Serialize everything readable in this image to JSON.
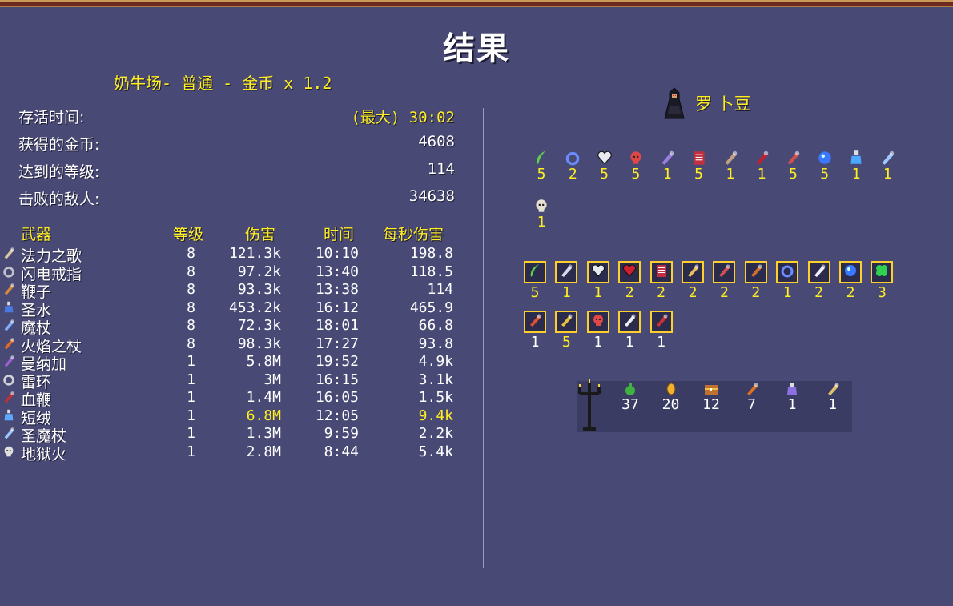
{
  "title": "结果",
  "stage_info": "奶牛场- 普通 - 金币 x 1.2",
  "stats": [
    {
      "label": "存活时间:",
      "prefix": "(最大)",
      "value": "30:02"
    },
    {
      "label": "获得的金币:",
      "prefix": "",
      "value": "4608"
    },
    {
      "label": "达到的等级:",
      "prefix": "",
      "value": "114"
    },
    {
      "label": "击败的敌人:",
      "prefix": "",
      "value": "34638"
    }
  ],
  "table": {
    "headers": {
      "weapon": "武器",
      "level": "等级",
      "damage": "伤害",
      "time": "时间",
      "dps": "每秒伤害"
    },
    "rows": [
      {
        "icon": "scroll-icon",
        "color": "#d9c7a8",
        "name": "法力之歌",
        "level": "8",
        "damage": "121.3k",
        "time": "10:10",
        "dps": "198.8",
        "highlight": false
      },
      {
        "icon": "ring-icon",
        "color": "#c0c0c8",
        "name": "闪电戒指",
        "level": "8",
        "damage": "97.2k",
        "time": "13:40",
        "dps": "118.5",
        "highlight": false
      },
      {
        "icon": "whip-icon",
        "color": "#d88a3a",
        "name": "鞭子",
        "level": "8",
        "damage": "93.3k",
        "time": "13:38",
        "dps": "114",
        "highlight": false
      },
      {
        "icon": "holy-water-icon",
        "color": "#4a78e0",
        "name": "圣水",
        "level": "8",
        "damage": "453.2k",
        "time": "16:12",
        "dps": "465.9",
        "highlight": false
      },
      {
        "icon": "wand-icon",
        "color": "#7fb0ff",
        "name": "魔杖",
        "level": "8",
        "damage": "72.3k",
        "time": "18:01",
        "dps": "66.8",
        "highlight": false
      },
      {
        "icon": "fire-wand-icon",
        "color": "#e06a2a",
        "name": "火焰之杖",
        "level": "8",
        "damage": "98.3k",
        "time": "17:27",
        "dps": "93.8",
        "highlight": false
      },
      {
        "icon": "mannajja-icon",
        "color": "#9b5fd0",
        "name": "曼纳加",
        "level": "1",
        "damage": "5.8M",
        "time": "19:52",
        "dps": "4.9k",
        "highlight": false
      },
      {
        "icon": "thunder-loop-icon",
        "color": "#d0d0d8",
        "name": "雷环",
        "level": "1",
        "damage": "3M",
        "time": "16:15",
        "dps": "3.1k",
        "highlight": false
      },
      {
        "icon": "bloody-whip-icon",
        "color": "#c0303a",
        "name": "血鞭",
        "level": "1",
        "damage": "1.4M",
        "time": "16:05",
        "dps": "1.5k",
        "highlight": false
      },
      {
        "icon": "flask-icon",
        "color": "#5fa8ff",
        "name": "短绒",
        "level": "1",
        "damage": "6.8M",
        "time": "12:05",
        "dps": "9.4k",
        "highlight": true
      },
      {
        "icon": "holy-wand-icon",
        "color": "#a0c8ff",
        "name": "圣魔杖",
        "level": "1",
        "damage": "1.3M",
        "time": "9:59",
        "dps": "2.2k",
        "highlight": false
      },
      {
        "icon": "skull-icon",
        "color": "#e0e0e0",
        "name": "地狱火",
        "level": "1",
        "damage": "2.8M",
        "time": "8:44",
        "dps": "5.4k",
        "highlight": false
      }
    ]
  },
  "character": {
    "name": "罗 卜豆",
    "sprite": "hooded-figure-icon"
  },
  "weapon_icons": [
    {
      "icon": "feather-icon",
      "color": "#5fd04a",
      "count": "5"
    },
    {
      "icon": "ring-icon",
      "color": "#6a8cff",
      "count": "2"
    },
    {
      "icon": "heart-icon",
      "color": "#e8e8f0",
      "count": "5"
    },
    {
      "icon": "skull-red-icon",
      "color": "#e04848",
      "count": "5"
    },
    {
      "icon": "wand-star-icon",
      "color": "#9b7fe0",
      "count": "1"
    },
    {
      "icon": "book-icon",
      "color": "#c03040",
      "count": "5"
    },
    {
      "icon": "clock-icon",
      "color": "#c0a080",
      "count": "1"
    },
    {
      "icon": "red-whip-icon",
      "color": "#c02030",
      "count": "1"
    },
    {
      "icon": "gauntlet-icon",
      "color": "#d05050",
      "count": "5"
    },
    {
      "icon": "orb-icon",
      "color": "#3a78ff",
      "count": "5"
    },
    {
      "icon": "potion-icon",
      "color": "#4aa8ff",
      "count": "1"
    },
    {
      "icon": "holy-wand-icon",
      "color": "#a0c8ff",
      "count": "1"
    },
    {
      "icon": "skull-icon",
      "color": "#e8e0d0",
      "count": "1"
    }
  ],
  "passive_items": [
    {
      "icon": "feather-icon",
      "color": "#5fd04a",
      "count": "5"
    },
    {
      "icon": "wings-icon",
      "color": "#d8d8e8",
      "count": "1"
    },
    {
      "icon": "heart-icon",
      "color": "#e8e8f0",
      "count": "1"
    },
    {
      "icon": "bleeding-heart-icon",
      "color": "#d02030",
      "count": "2"
    },
    {
      "icon": "tome-icon",
      "color": "#c03040",
      "count": "2"
    },
    {
      "icon": "candelabra-icon",
      "color": "#e8c060",
      "count": "2"
    },
    {
      "icon": "gauntlet-icon",
      "color": "#d05050",
      "count": "2"
    },
    {
      "icon": "crossed-swords-icon",
      "color": "#d07030",
      "count": "2"
    },
    {
      "icon": "ring-icon",
      "color": "#6a8cff",
      "count": "1"
    },
    {
      "icon": "wing-icon",
      "color": "#f0f0ff",
      "count": "2"
    },
    {
      "icon": "orb-icon",
      "color": "#3a78ff",
      "count": "2"
    },
    {
      "icon": "clover-icon",
      "color": "#30d050",
      "count": "3"
    },
    {
      "icon": "fire-crown-icon",
      "color": "#e05030",
      "count": "1"
    },
    {
      "icon": "helmet-icon",
      "color": "#e8c040",
      "count": "5"
    },
    {
      "icon": "skull-red-icon",
      "color": "#e04848",
      "count": "1"
    },
    {
      "icon": "dice-icon",
      "color": "#f0f0f0",
      "count": "1"
    },
    {
      "icon": "ghost-icon",
      "color": "#d03030",
      "count": "1"
    }
  ],
  "passive_highlight_index": 13,
  "pickups": [
    {
      "icon": "money-bag-icon",
      "color": "#40b040",
      "count": "37"
    },
    {
      "icon": "gold-coin-icon",
      "color": "#f0b030",
      "count": "20"
    },
    {
      "icon": "treasure-chest-icon",
      "color": "#c07030",
      "count": "12"
    },
    {
      "icon": "roast-chicken-icon",
      "color": "#e07020",
      "count": "7"
    },
    {
      "icon": "magic-potion-icon",
      "color": "#8a70e0",
      "count": "1"
    },
    {
      "icon": "orologion-icon",
      "color": "#e0c070",
      "count": "1"
    }
  ],
  "colors": {
    "background": "#484a75",
    "accent": "#ffee22",
    "divider": "#9a9bb8"
  }
}
